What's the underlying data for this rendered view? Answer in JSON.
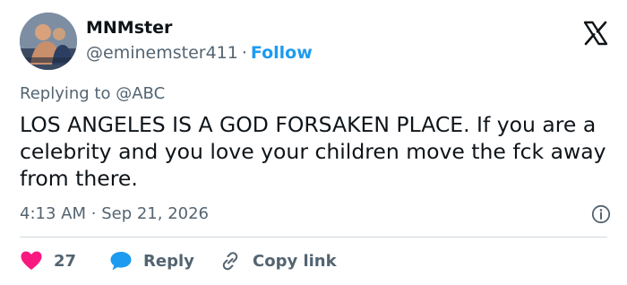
{
  "author": {
    "display_name": "MNMster",
    "handle": "@eminemster411",
    "separator": "·",
    "follow_label": "Follow"
  },
  "reply_context": {
    "prefix": "Replying to",
    "mention": "@ABC"
  },
  "tweet": {
    "text": "LOS ANGELES IS A GOD FORSAKEN PLACE. If you are a celebrity and you love your children move the fck away from there."
  },
  "meta": {
    "time": "4:13 AM",
    "separator": "·",
    "date": "Sep 21, 2026"
  },
  "actions": {
    "like_count": "27",
    "reply_label": "Reply",
    "copy_label": "Copy link"
  },
  "icons": {
    "brand": "x-logo-icon",
    "like": "heart-icon",
    "reply": "speech-bubble-icon",
    "copy": "link-icon",
    "info": "info-icon"
  },
  "colors": {
    "text": "#0f1419",
    "muted": "#536471",
    "accent": "#1d9bf0",
    "like": "#f91880",
    "divider": "#cfd9de"
  }
}
